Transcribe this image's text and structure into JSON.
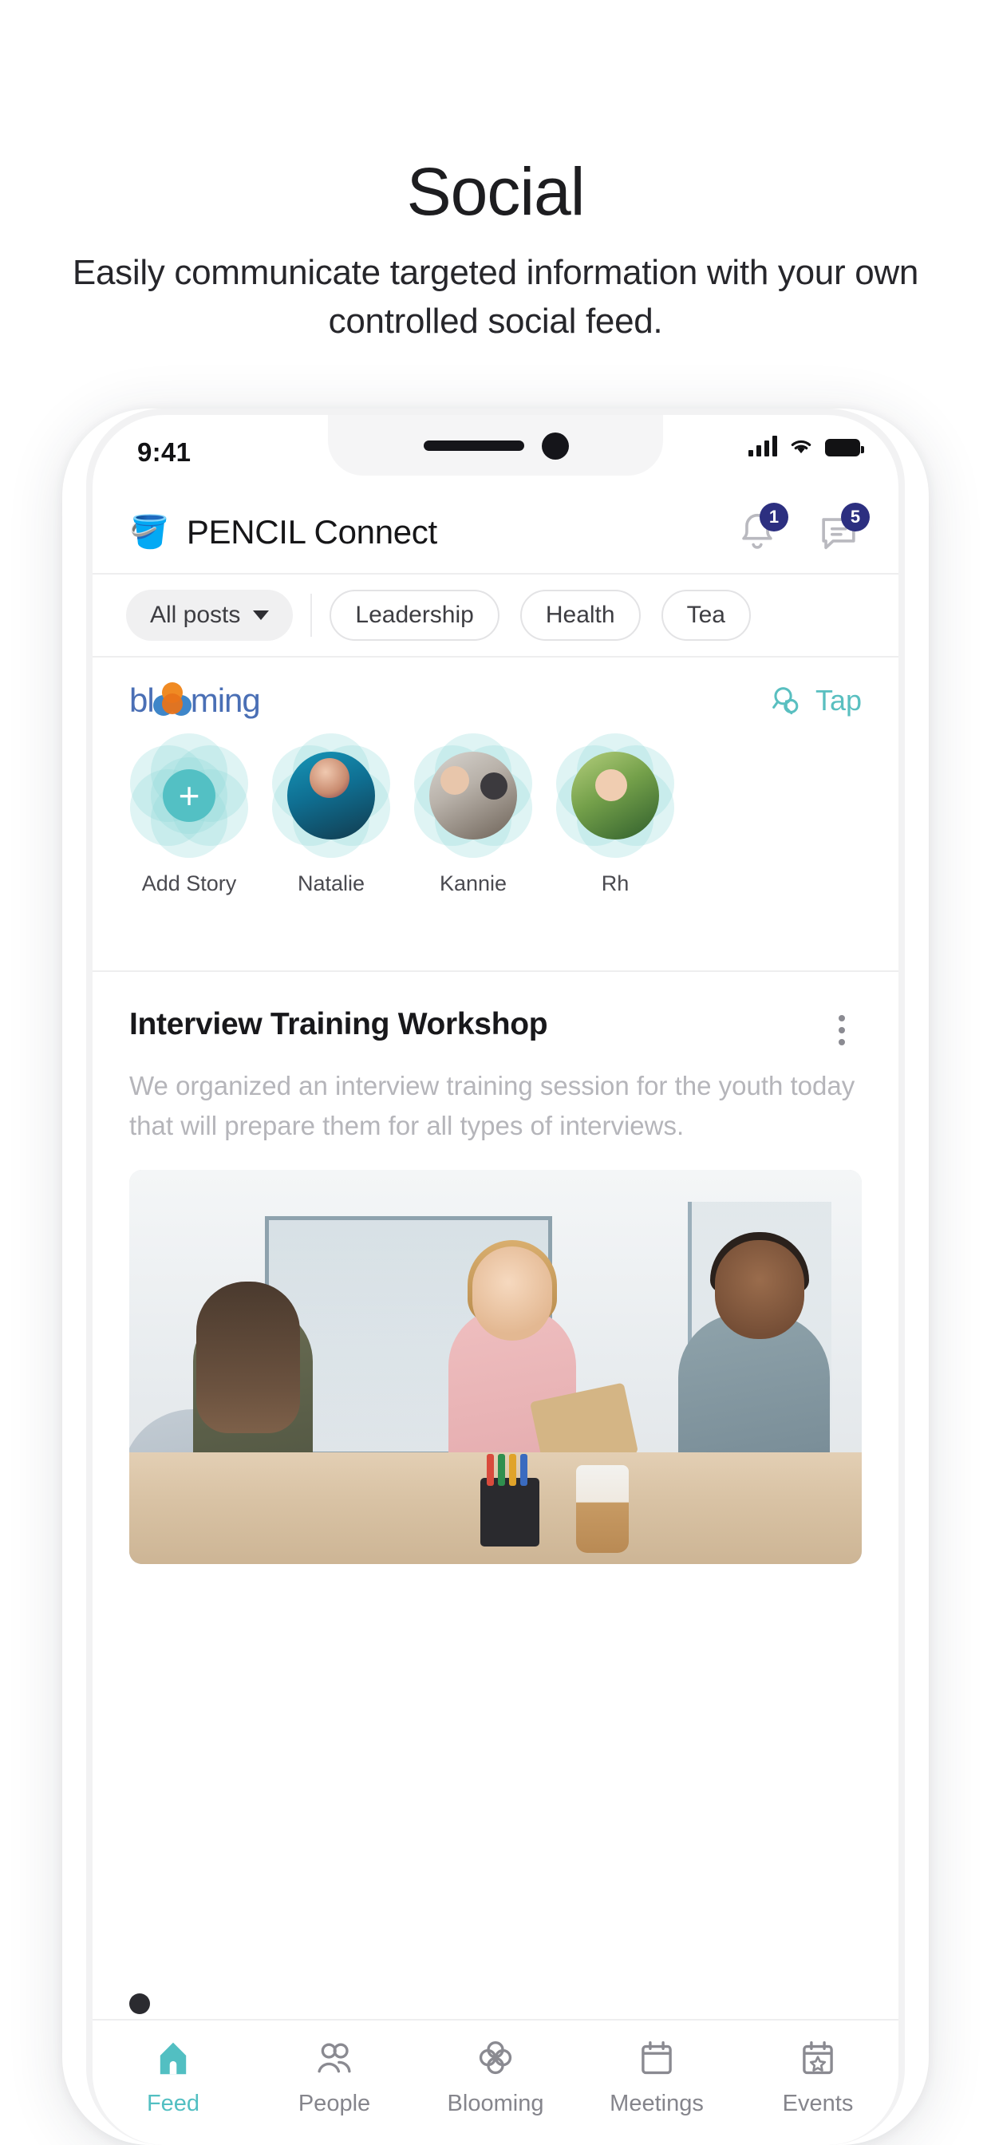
{
  "promo": {
    "title": "Social",
    "subtitle": "Easily communicate targeted information with your own controlled social feed."
  },
  "colors": {
    "accent_teal": "#52bfc2",
    "badge_navy": "#2c2f80",
    "brand_blue": "#4a6fb5",
    "brand_orange": "#f08a23",
    "text_primary": "#18181b",
    "text_muted": "#b5b5ba"
  },
  "status_bar": {
    "time": "9:41",
    "signal_icon": "cellular-signal-icon",
    "wifi_icon": "wifi-icon",
    "battery_icon": "battery-icon"
  },
  "app_header": {
    "logo_icon": "pencil-cup-icon",
    "logo_glyph": "🪣",
    "title": "PENCIL Connect",
    "actions": [
      {
        "name": "notifications-button",
        "icon": "bell-icon",
        "badge": "1"
      },
      {
        "name": "messages-button",
        "icon": "chat-icon",
        "badge": "5"
      }
    ]
  },
  "filters": {
    "selected": {
      "label": "All posts",
      "icon": "chevron-down-icon"
    },
    "chips": [
      {
        "label": "Leadership"
      },
      {
        "label": "Health"
      },
      {
        "label": "Tea"
      }
    ]
  },
  "stories_section": {
    "logo_text_left": "bl",
    "logo_text_right": "ming",
    "logo_flower_icon": "blooming-flower-icon",
    "tap": {
      "label": "Tap",
      "icon": "tap-search-icon"
    },
    "items": [
      {
        "name": "Add Story",
        "type": "add",
        "icon": "plus-icon"
      },
      {
        "name": "Natalie",
        "type": "avatar",
        "avatar_class": "av-a"
      },
      {
        "name": "Kannie",
        "type": "avatar",
        "avatar_class": "av-b"
      },
      {
        "name": "Rh",
        "type": "avatar",
        "avatar_class": "av-c"
      }
    ]
  },
  "post": {
    "title": "Interview Training Workshop",
    "body": "We organized an interview training session for the youth today that will prepare them for all types of interviews.",
    "menu_icon": "kebab-menu-icon",
    "image_alt": "office-handshake-photo"
  },
  "tabbar": {
    "items": [
      {
        "label": "Feed",
        "icon": "home-icon",
        "active": true
      },
      {
        "label": "People",
        "icon": "people-icon",
        "active": false
      },
      {
        "label": "Blooming",
        "icon": "blooming-clover-icon",
        "active": false
      },
      {
        "label": "Meetings",
        "icon": "calendar-icon",
        "active": false
      },
      {
        "label": "Events",
        "icon": "calendar-star-icon",
        "active": false
      }
    ]
  }
}
